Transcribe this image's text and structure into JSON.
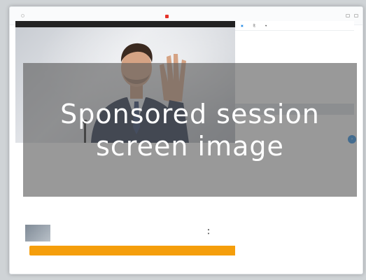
{
  "overlay": {
    "line1": "Sponsored session",
    "line2": "screen image"
  },
  "colors": {
    "accent": "#1e88e5",
    "cta": "#f59e0b",
    "banner_text": "#e53935"
  },
  "icons": [
    "logo-mark",
    "chat-icon",
    "share-icon",
    "heart-icon",
    "arrow-up-icon",
    "arrow-down-icon"
  ]
}
